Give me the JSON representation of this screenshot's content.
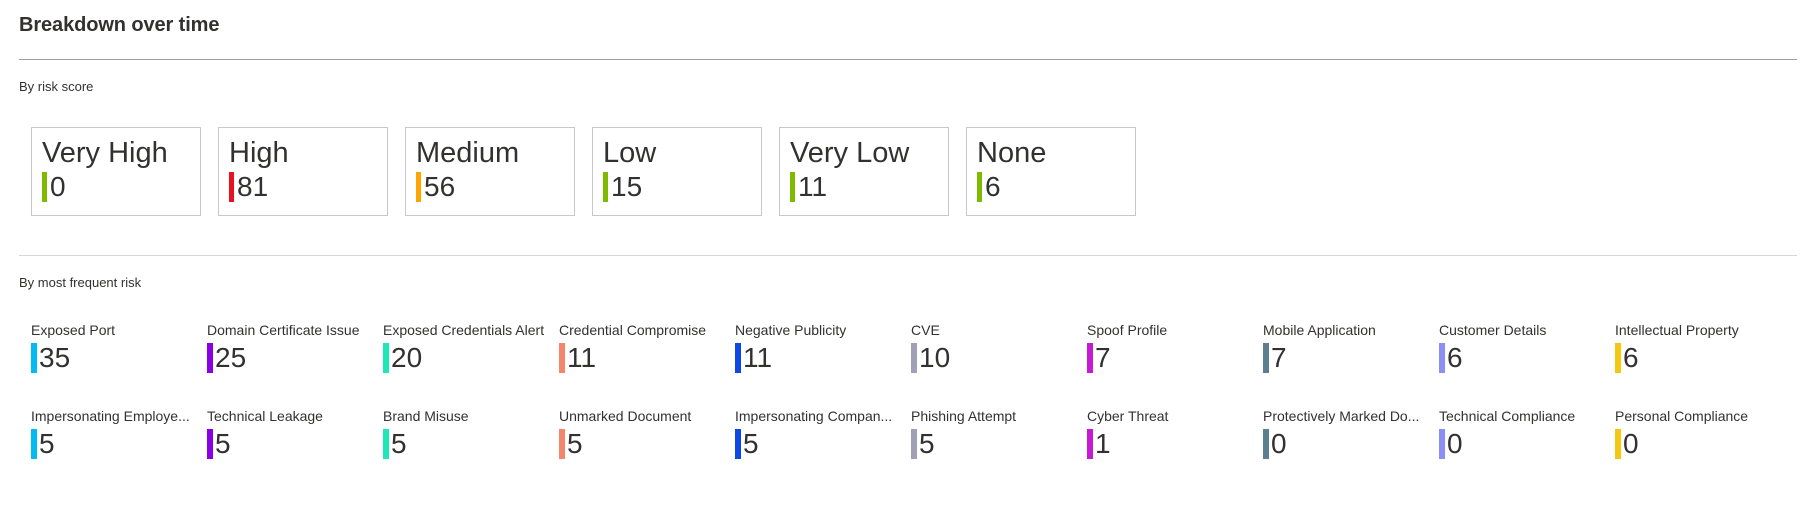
{
  "page": {
    "title": "Breakdown over time"
  },
  "risk_score": {
    "label": "By risk score",
    "cards": [
      {
        "name": "Very High",
        "value": "0",
        "color": "#7fba00"
      },
      {
        "name": "High",
        "value": "81",
        "color": "#e81123"
      },
      {
        "name": "Medium",
        "value": "56",
        "color": "#ffa500"
      },
      {
        "name": "Low",
        "value": "15",
        "color": "#7fba00"
      },
      {
        "name": "Very Low",
        "value": "11",
        "color": "#7fba00"
      },
      {
        "name": "None",
        "value": "6",
        "color": "#7fba00"
      }
    ]
  },
  "frequent_risk": {
    "label": "By most frequent risk",
    "items": [
      {
        "name": "Exposed Port",
        "value": "35",
        "color": "#00bcf2"
      },
      {
        "name": "Domain Certificate Issue",
        "value": "25",
        "color": "#8a00e6"
      },
      {
        "name": "Exposed Credentials Alert",
        "value": "20",
        "color": "#1de9b6"
      },
      {
        "name": "Credential Compromise",
        "value": "11",
        "color": "#f4876b"
      },
      {
        "name": "Negative Publicity",
        "value": "11",
        "color": "#0d47e6"
      },
      {
        "name": "CVE",
        "value": "10",
        "color": "#a0a0b8"
      },
      {
        "name": "Spoof Profile",
        "value": "7",
        "color": "#c719d6"
      },
      {
        "name": "Mobile Application",
        "value": "7",
        "color": "#5c7f8f"
      },
      {
        "name": "Customer Details",
        "value": "6",
        "color": "#8c8ff5"
      },
      {
        "name": "Intellectual Property",
        "value": "6",
        "color": "#f2c811"
      },
      {
        "name": "Impersonating Employe...",
        "value": "5",
        "color": "#00bcf2"
      },
      {
        "name": "Technical Leakage",
        "value": "5",
        "color": "#8a00e6"
      },
      {
        "name": "Brand Misuse",
        "value": "5",
        "color": "#1de9b6"
      },
      {
        "name": "Unmarked Document",
        "value": "5",
        "color": "#f4876b"
      },
      {
        "name": "Impersonating Compan...",
        "value": "5",
        "color": "#0d47e6"
      },
      {
        "name": "Phishing Attempt",
        "value": "5",
        "color": "#a0a0b8"
      },
      {
        "name": "Cyber Threat",
        "value": "1",
        "color": "#c719d6"
      },
      {
        "name": "Protectively Marked Do...",
        "value": "0",
        "color": "#5c7f8f"
      },
      {
        "name": "Technical Compliance",
        "value": "0",
        "color": "#8c8ff5"
      },
      {
        "name": "Personal Compliance",
        "value": "0",
        "color": "#f2c811"
      }
    ]
  }
}
